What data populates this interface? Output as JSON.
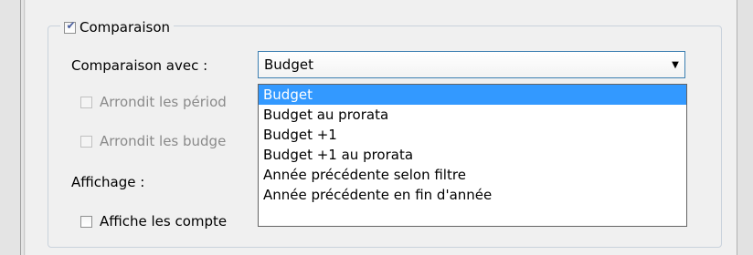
{
  "comparison": {
    "checkbox_label": "Comparaison",
    "checked": true,
    "compare_with_label": "Comparaison avec :",
    "combo": {
      "value": "Budget",
      "options": [
        "Budget",
        "Budget au prorata",
        "Budget +1",
        "Budget +1 au prorata",
        "Année précédente selon filtre",
        "Année précédente en fin d'année"
      ],
      "selected_index": 0
    },
    "round_periods_label": "Arrondit les périod",
    "round_budgets_label": "Arrondit les budge",
    "display_label": "Affichage :",
    "show_accounts_label": "Affiche les compte"
  },
  "icons": {
    "check": "check-icon",
    "dropdown_arrow": "chevron-down-icon"
  },
  "colors": {
    "selection": "#3399ff",
    "combo_border": "#3c7fb1",
    "groupbox_border": "#c9d2dc"
  }
}
